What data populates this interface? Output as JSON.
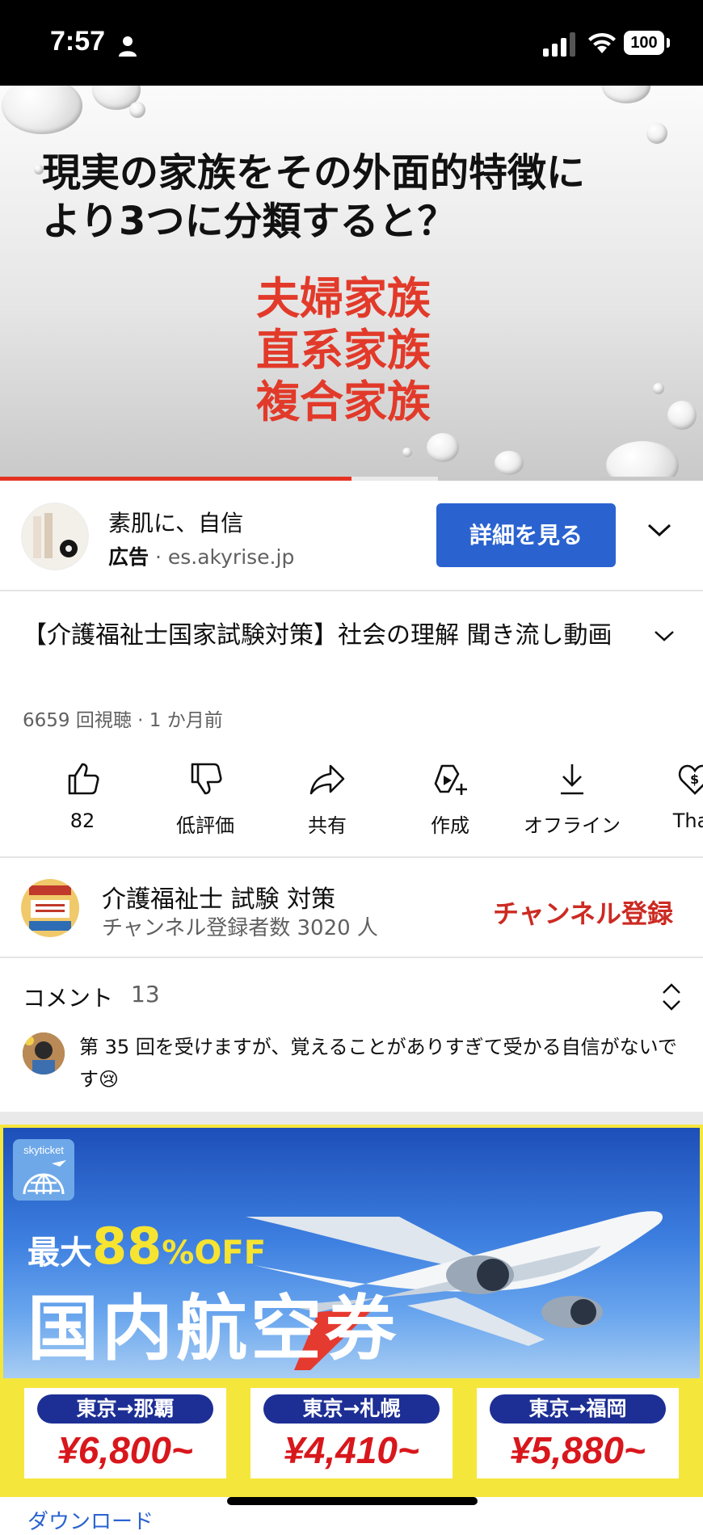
{
  "status_bar": {
    "time": "7:57",
    "battery": "100"
  },
  "video": {
    "title_line1": "現実の家族をその外面的特徴に",
    "title_line2": "より3つに分類すると？",
    "list": [
      "夫婦家族",
      "直系家族",
      "複合家族"
    ],
    "progress_fraction": 0.5
  },
  "ad": {
    "title": "素肌に、自信",
    "label": "広告",
    "domain": "es.akyrise.jp",
    "button": "詳細を見る"
  },
  "video_info": {
    "title": "【介護福祉士国家試験対策】社会の理解 聞き流し動画",
    "meta": "6659 回視聴 · 1 か月前"
  },
  "actions": [
    {
      "label": "82",
      "icon": "thumbs-up-icon"
    },
    {
      "label": "低評価",
      "icon": "thumbs-down-icon"
    },
    {
      "label": "共有",
      "icon": "share-icon"
    },
    {
      "label": "作成",
      "icon": "create-icon"
    },
    {
      "label": "オフライン",
      "icon": "download-icon"
    },
    {
      "label": "Thar",
      "icon": "thanks-icon"
    }
  ],
  "channel": {
    "name": "介護福祉士 試験 対策",
    "subscribers": "チャンネル登録者数 3020 人",
    "subscribe_button": "チャンネル登録"
  },
  "comments": {
    "heading": "コメント",
    "count": "13",
    "top_comment": "第 35 回を受けますが、覚えることがありすぎて受かる自信がないです😢"
  },
  "banner": {
    "logo": "skyticket",
    "promo_prefix": "最大",
    "promo_percent": "88",
    "promo_suffix": "%OFF",
    "headline": "国内航空券",
    "tickets": [
      {
        "route": "東京→那覇",
        "price": "¥6,800~"
      },
      {
        "route": "東京→札幌",
        "price": "¥4,410~"
      },
      {
        "route": "東京→福岡",
        "price": "¥5,880~"
      }
    ]
  },
  "bottom": {
    "link": "ダウンロード"
  }
}
